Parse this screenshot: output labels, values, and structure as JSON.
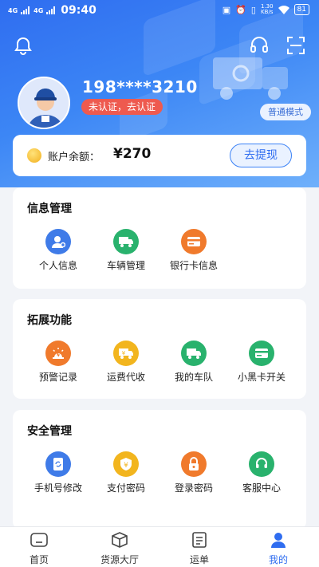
{
  "status_bar": {
    "signal_1": "4G",
    "signal_2": "4G",
    "time": "09:40",
    "net_speed": "1.30",
    "net_unit": "KB/s",
    "battery": "81"
  },
  "header": {
    "bell_icon": "bell-icon",
    "headset_icon": "headset-icon",
    "scan_icon": "scan-icon",
    "phone": "198****3210",
    "cert_status": "未认证，去认证",
    "mode": "普通模式"
  },
  "balance": {
    "label": "账户余额：",
    "value": "¥270",
    "withdraw": "去提现"
  },
  "sections": {
    "info": {
      "title": "信息管理",
      "items": [
        {
          "label": "个人信息",
          "icon": "person-icon",
          "color": "#3f7be8"
        },
        {
          "label": "车辆管理",
          "icon": "truck-icon",
          "color": "#29b26d"
        },
        {
          "label": "银行卡信息",
          "icon": "card-icon",
          "color": "#f07a2c"
        }
      ]
    },
    "ext": {
      "title": "拓展功能",
      "items": [
        {
          "label": "预警记录",
          "icon": "warning-icon",
          "color": "#f07a2c"
        },
        {
          "label": "运费代收",
          "icon": "freight-icon",
          "color": "#f2b51e"
        },
        {
          "label": "我的车队",
          "icon": "fleet-icon",
          "color": "#29b26d"
        },
        {
          "label": "小黑卡开关",
          "icon": "black-card-icon",
          "color": "#29b26d"
        }
      ]
    },
    "security": {
      "title": "安全管理",
      "items": [
        {
          "label": "手机号修改",
          "icon": "phone-icon",
          "color": "#3f7be8"
        },
        {
          "label": "支付密码",
          "icon": "pay-shield-icon",
          "color": "#f2b51e"
        },
        {
          "label": "登录密码",
          "icon": "lock-icon",
          "color": "#f07a2c"
        },
        {
          "label": "客服中心",
          "icon": "support-icon",
          "color": "#29b26d"
        }
      ]
    }
  },
  "nav": [
    {
      "label": "首页",
      "icon": "home-icon"
    },
    {
      "label": "货源大厅",
      "icon": "box-icon"
    },
    {
      "label": "运单",
      "icon": "waybill-icon"
    },
    {
      "label": "我的",
      "icon": "profile-icon"
    }
  ],
  "colors": {
    "brand_blue": "#2f6df0",
    "alert_red": "#ee5a4f",
    "green": "#29b26d",
    "orange": "#f07a2c",
    "yellow": "#f2b51e"
  }
}
